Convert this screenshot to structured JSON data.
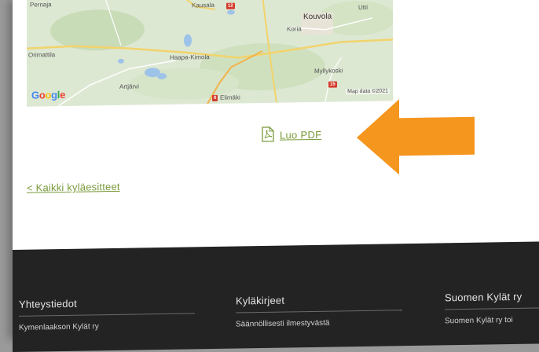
{
  "map": {
    "places": {
      "pernaja": "Pernaja",
      "kausala": "Kausala",
      "kouvola": "Kouvola",
      "koria": "Koria",
      "utti": "Utti",
      "orimattila": "Orimattila",
      "hoapa_kimola": "Haapa-Kimola",
      "myllykoski": "Myllykoski",
      "artjarvi": "Artjärvi",
      "elimaki": "Elimäki"
    },
    "road_numbers": {
      "r12": "12",
      "r15": "15",
      "r6": "6"
    },
    "google_logo": "Google",
    "credit": "Map data ©2021"
  },
  "actions": {
    "pdf_label": "Luo PDF",
    "pdf_icon": "pdf-document-icon",
    "back_label": "< Kaikki kyläesitteet"
  },
  "colors": {
    "link": "#7a9a3a",
    "arrow": "#f5961f",
    "footer_bg": "#232323"
  },
  "footer": {
    "columns": [
      {
        "title": "Yhteystiedot",
        "text": "Kymenlaakson Kylät ry"
      },
      {
        "title": "Kyläkirjeet",
        "text": "Säännöllisesti ilmestyvästä"
      },
      {
        "title": "Suomen Kylät ry",
        "text": "Suomen Kylät ry toi"
      }
    ]
  }
}
